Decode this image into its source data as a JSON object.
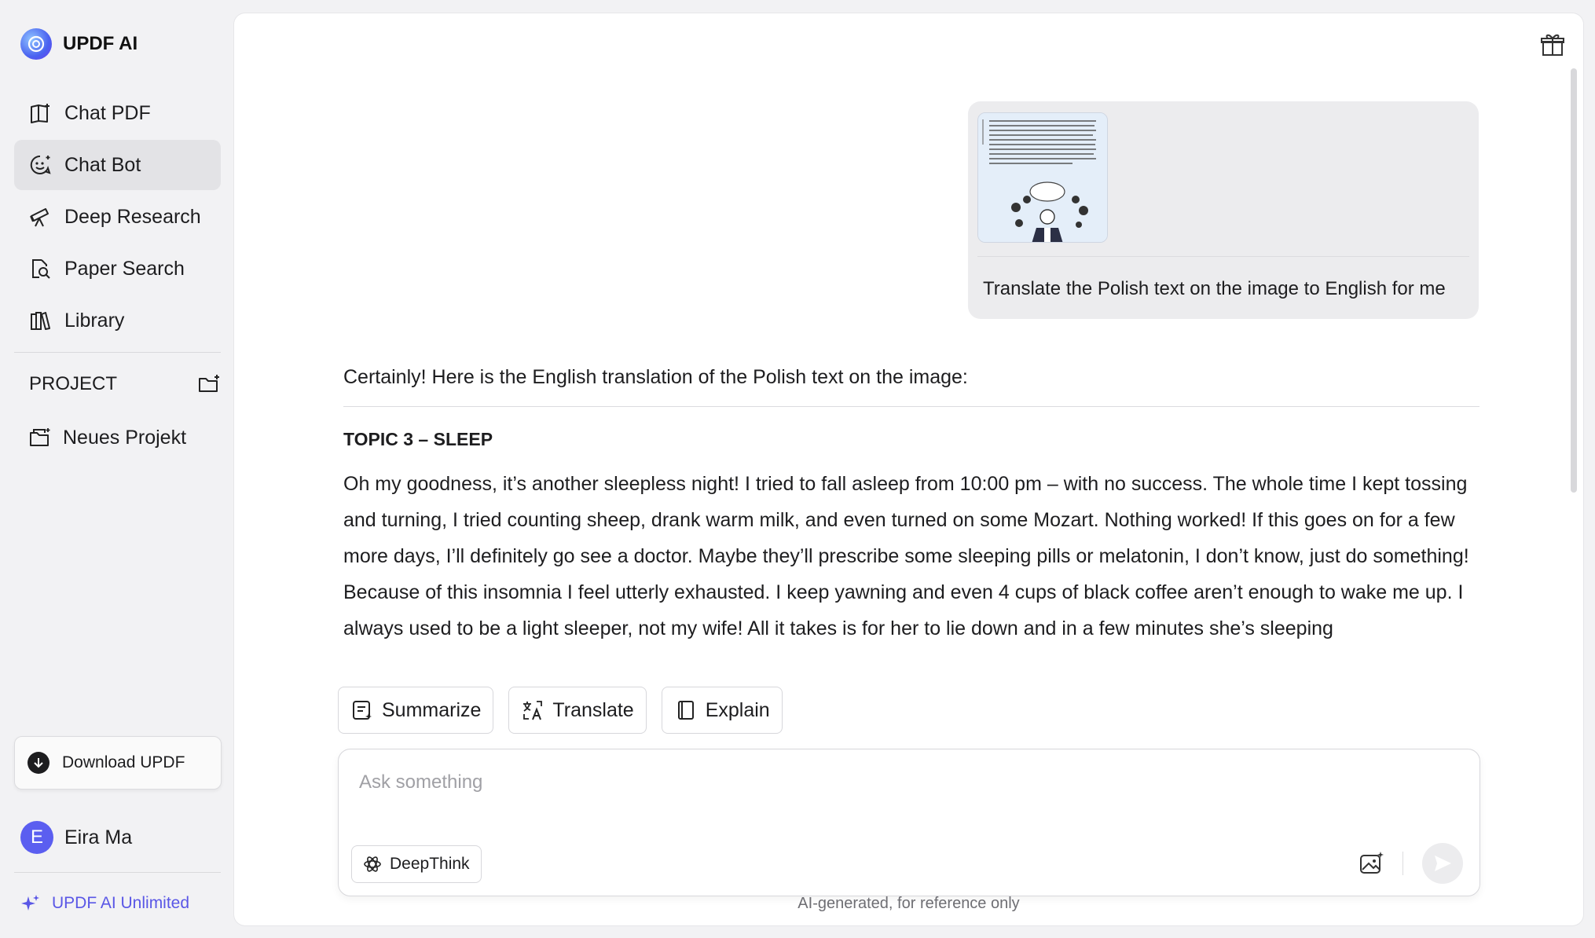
{
  "app": {
    "name": "UPDF AI"
  },
  "sidebar": {
    "items": [
      {
        "label": "Chat PDF",
        "icon": "chat-pdf-icon",
        "active": false
      },
      {
        "label": "Chat Bot",
        "icon": "chat-bot-icon",
        "active": true
      },
      {
        "label": "Deep Research",
        "icon": "telescope-icon",
        "active": false
      },
      {
        "label": "Paper Search",
        "icon": "paper-search-icon",
        "active": false
      },
      {
        "label": "Library",
        "icon": "library-icon",
        "active": false
      }
    ],
    "project_header": "PROJECT",
    "projects": [
      {
        "label": "Neues Projekt",
        "icon": "folder-icon"
      }
    ],
    "download_label": "Download UPDF",
    "user": {
      "initial": "E",
      "name": "Eira Ma"
    },
    "plan_label": "UPDF AI Unlimited"
  },
  "chat": {
    "user_message": {
      "has_image": true,
      "text": "Translate the Polish text on the image to English for me"
    },
    "answer": {
      "intro": "Certainly! Here is the English translation of the Polish text on the image:",
      "heading": "TOPIC 3 – SLEEP",
      "body": "Oh my goodness, it’s another sleepless night! I tried to fall asleep from 10:00 pm – with no success. The whole time I kept tossing and turning, I tried counting sheep, drank warm milk, and even turned on some Mozart. Nothing worked! If this goes on for a few more days, I’ll definitely go see a doctor. Maybe they’ll prescribe some sleeping pills or melatonin, I don’t know, just do something! Because of this insomnia I feel utterly exhausted. I keep yawning and even 4 cups of black coffee aren’t enough to wake me up. I always used to be a light sleeper, not my wife! All it takes is for her to lie down and in a few minutes she’s sleeping"
    },
    "actions": [
      {
        "label": "Summarize",
        "icon": "summarize-icon"
      },
      {
        "label": "Translate",
        "icon": "translate-icon"
      },
      {
        "label": "Explain",
        "icon": "book-icon"
      }
    ]
  },
  "composer": {
    "placeholder": "Ask something",
    "value": "",
    "deepthink_label": "DeepThink"
  },
  "footer": {
    "disclaimer": "AI-generated, for reference only"
  },
  "colors": {
    "accent": "#5a57e6",
    "active_bg": "#e3e3e6",
    "avatar": "#5b5ef0"
  }
}
